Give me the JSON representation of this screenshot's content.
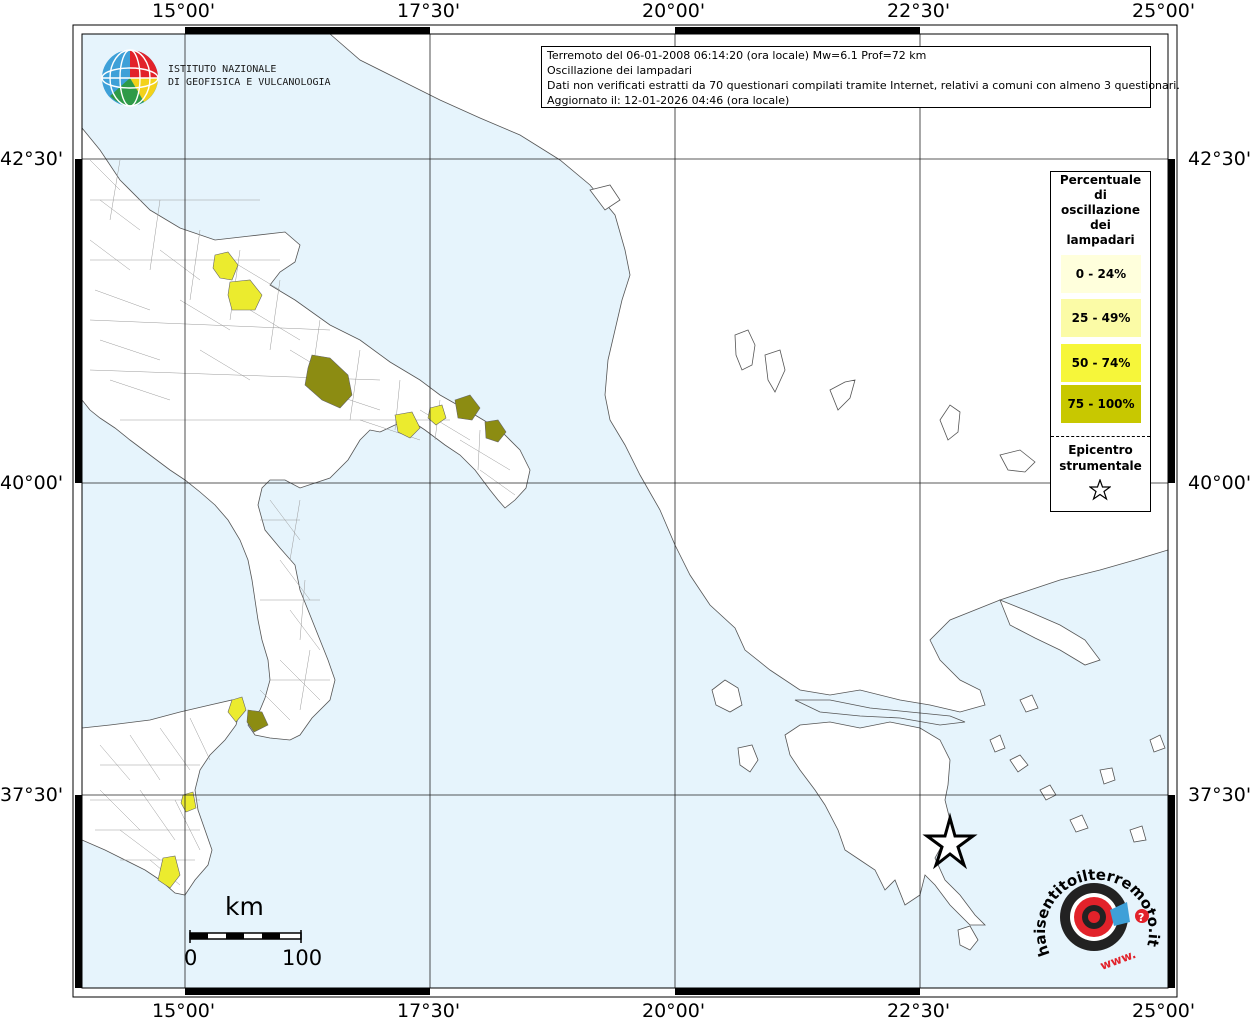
{
  "header": {
    "line1": "Terremoto del 06-01-2008 06:14:20 (ora locale) Mw=6.1 Prof=72 km",
    "line2": "Oscillazione dei lampadari",
    "line3": "Dati non verificati estratti da 70 questionari compilati tramite Internet, relativi a comuni con almeno 3 questionari.",
    "line4": "Aggiornato il: 12-01-2026 04:46 (ora locale)"
  },
  "logo": {
    "line1": "ISTITUTO NAZIONALE",
    "line2": "DI GEOFISICA E VULCANOLOGIA"
  },
  "axes": {
    "lon_top": [
      "15°00'",
      "17°30'",
      "20°00'",
      "22°30'",
      "25°00'"
    ],
    "lon_bottom": [
      "15°00'",
      "17°30'",
      "20°00'",
      "22°30'",
      "25°00'"
    ],
    "lat_left": [
      "42°30'",
      "40°00'",
      "37°30'"
    ],
    "lat_right": [
      "42°30'",
      "40°00'",
      "37°30'"
    ]
  },
  "legend": {
    "title_lines": [
      "Percentuale",
      "di",
      "oscillazione",
      "dei",
      "lampadari"
    ],
    "items": [
      {
        "label": "0 - 24%",
        "color": "#ffffdc"
      },
      {
        "label": "25 - 49%",
        "color": "#fbfba6"
      },
      {
        "label": "50 - 74%",
        "color": "#f6f63a"
      },
      {
        "label": "75 - 100%",
        "color": "#c8c800"
      }
    ],
    "epicenter_lines": [
      "Epicentro",
      "strumentale"
    ]
  },
  "scale": {
    "unit": "km",
    "left": "0",
    "right": "100"
  },
  "watermark": {
    "text": "haisentitoilterremoto.it",
    "www": "www."
  },
  "colors": {
    "sea": "#e6f4fc",
    "land": "#ffffff",
    "yellow_pale": "#ebeb2e",
    "olive": "#8c8c12",
    "olive_light": "#b3b322"
  }
}
